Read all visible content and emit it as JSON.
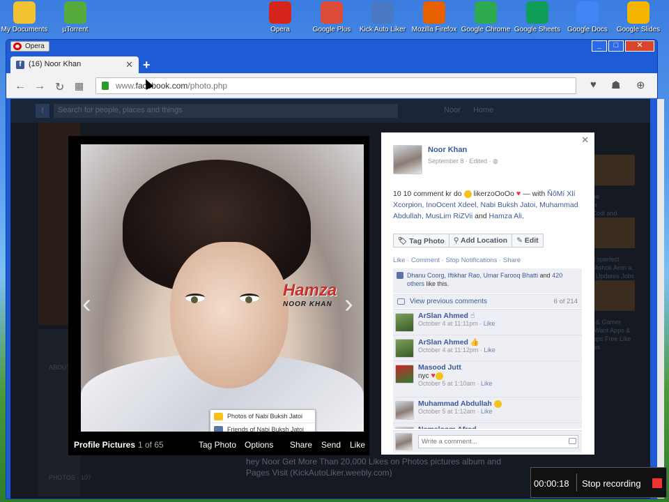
{
  "desktop_icons": [
    {
      "label": "My Documents",
      "color": "#f1c232"
    },
    {
      "label": "µTorrent",
      "color": "#56a93b"
    },
    {
      "label": "Opera",
      "color": "#d4241b"
    },
    {
      "label": "Google Plus",
      "color": "#dd4b39"
    },
    {
      "label": "Kick Auto Liker",
      "color": "#4a78c2"
    },
    {
      "label": "Mozilla Firefox",
      "color": "#e66000"
    },
    {
      "label": "Google Chrome",
      "color": "#2da94f"
    },
    {
      "label": "Google Sheets",
      "color": "#0f9d58"
    },
    {
      "label": "Google Docs",
      "color": "#4285f4"
    },
    {
      "label": "Google Slides",
      "color": "#f4b400"
    }
  ],
  "browser": {
    "menu_label": "Opera",
    "tab_title": "(16) Noor Khan",
    "url_prefix": "www.",
    "url_host": "facebook.com",
    "url_path": "/photo.php"
  },
  "fb_background": {
    "search_placeholder": "Search for people, places and things",
    "user_name": "Noor",
    "home_label": "Home",
    "bottom_text": "hey Noor Get More Than 20,000 Likes on Photos pictures album and Pages Visit (KickAutoLiker.weebly.com)",
    "about_label": "ABOUT",
    "photos_label": "PHOTOS · 107",
    "right_snippets": [
      "Lee",
      "lim",
      "l Codi and",
      "ell sperfect",
      "& Ashok Aron a.",
      "e. Updates Jobs",
      "rs & Gamer",
      "u Want Apps &",
      "Apps Free  Like",
      "ews"
    ]
  },
  "viewer": {
    "album_label": "Profile Pictures",
    "position": "1 of 65",
    "actions": [
      "Tag Photo",
      "Options",
      "Share",
      "Send",
      "Like"
    ],
    "watermark_main": "Hamza",
    "watermark_sub": "NOOR KHAN",
    "album_menu": [
      "Photos of Nabi Buksh Jatoi",
      "Friends of Nabi Buksh Jatoi"
    ],
    "prev_arrow": "‹",
    "next_arrow": "›"
  },
  "panel": {
    "author": "Noor Khan",
    "date": "September 8 · Edited · ",
    "post_text_start": "10 10 comment kr do ",
    "post_text_mid": " likerzoOoOo ",
    "post_text_with": " — with ",
    "tagged_links": "ÑôMí Xlí Xcorpion, InoOcent Xdeel, Nabi Buksh Jatoi, Muhammad Abdullah, MusLim RiZVii",
    "post_text_and": " and ",
    "tagged_last": "Hamza Ali",
    "post_text_end": ".",
    "buttons": [
      "Tag Photo",
      "Add Location",
      "Edit"
    ],
    "actions": "Like · Comment · Stop Notifications · Share",
    "likes_names": "Dhanu Coorg, Iftikhar Rao, Umar Farooq Bhatti",
    "likes_and": " and ",
    "likes_others": "420 others",
    "likes_end": " like this.",
    "view_previous": "View previous comments",
    "comment_count": "6 of 214",
    "comments": [
      {
        "name": "ArSlan Ahmed",
        "text": "",
        "time": "October 4 at 11:11pm",
        "like": "Like"
      },
      {
        "name": "ArSlan Ahmed",
        "text": "",
        "time": "October 4 at 11:12pm",
        "like": "Like"
      },
      {
        "name": "Masood Jutt",
        "text": "nyc",
        "time": "October 5 at 1:10am",
        "like": "Like"
      },
      {
        "name": "Muhammad Abdullah",
        "text": "",
        "time": "October 5 at 1:12am",
        "like": "Like"
      },
      {
        "name": "Namaloom Afrad",
        "text": "",
        "time": "",
        "like": ""
      }
    ],
    "write_placeholder": "Write a comment..."
  },
  "recorder": {
    "time": "00:00:18",
    "stop_label": "Stop recording"
  }
}
